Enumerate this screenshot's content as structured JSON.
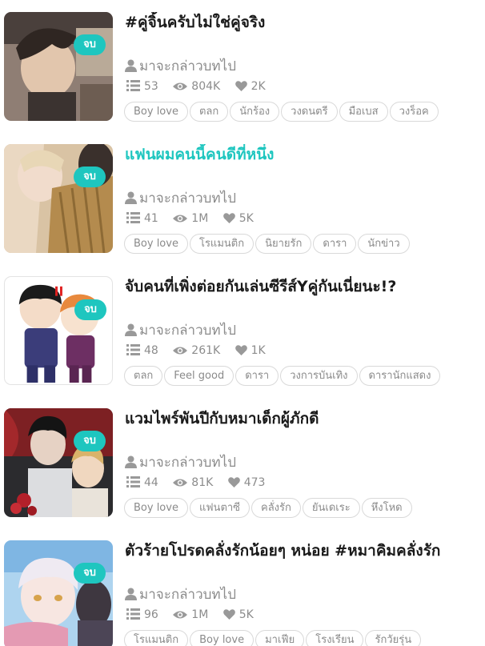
{
  "accent_color": "#1ec6bf",
  "items": [
    {
      "title": "#คู่จิ้นครับไม่ใช่คู่จริง",
      "badge": "จบ",
      "author": "มาจะกล่าวบทไป",
      "chapters": "53",
      "views": "804K",
      "likes": "2K",
      "tags": [
        "Boy love",
        "ตลก",
        "นักร้อง",
        "วงดนตรี",
        "มือเบส",
        "วงร็อค"
      ]
    },
    {
      "title": "แฟนผมคนนี้คนดีที่หนึ่ง",
      "badge": "จบ",
      "author": "มาจะกล่าวบทไป",
      "chapters": "41",
      "views": "1M",
      "likes": "5K",
      "tags": [
        "Boy love",
        "โรแมนติก",
        "นิยายรัก",
        "ดารา",
        "นักข่าว"
      ]
    },
    {
      "title": "จับคนที่เพิ่งต่อยกันเล่นซีรีส์Yคู่กันเนี่ยนะ!?",
      "badge": "จบ",
      "author": "มาจะกล่าวบทไป",
      "chapters": "48",
      "views": "261K",
      "likes": "1K",
      "tags": [
        "ตลก",
        "Feel good",
        "ดารา",
        "วงการบันเทิง",
        "ดารานักแสดง"
      ]
    },
    {
      "title": "แวมไพร์พันปีกับหมาเด็กผู้ภักดี",
      "badge": "จบ",
      "author": "มาจะกล่าวบทไป",
      "chapters": "44",
      "views": "81K",
      "likes": "473",
      "tags": [
        "Boy love",
        "แฟนตาซี",
        "คลั่งรัก",
        "ยันเดเระ",
        "หึงโหด"
      ]
    },
    {
      "title": "ตัวร้ายโปรดคลั่งรักน้อยๆ หน่อย #หมาคิมคลั่งรัก",
      "badge": "จบ",
      "author": "มาจะกล่าวบทไป",
      "chapters": "96",
      "views": "1M",
      "likes": "5K",
      "tags": [
        "โรแมนติก",
        "Boy love",
        "มาเฟีย",
        "โรงเรียน",
        "รักวัยรุ่น"
      ]
    }
  ]
}
